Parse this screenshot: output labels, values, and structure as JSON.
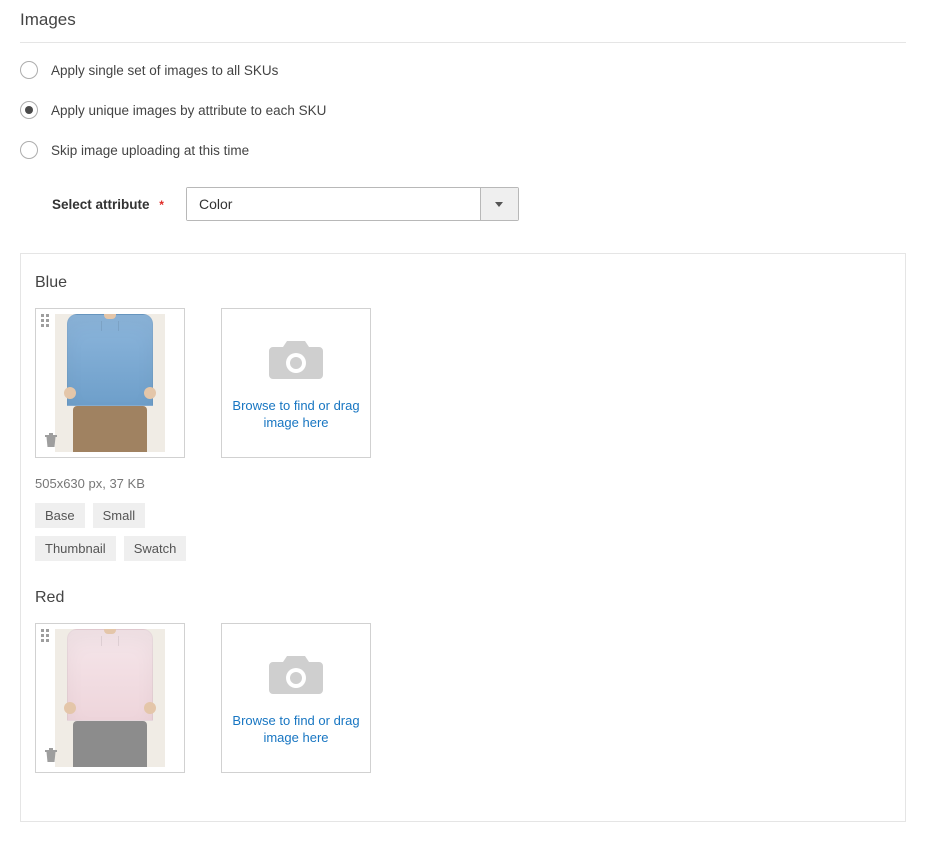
{
  "section_title": "Images",
  "radios": [
    {
      "label": "Apply single set of images to all SKUs",
      "selected": false
    },
    {
      "label": "Apply unique images by attribute to each SKU",
      "selected": true
    },
    {
      "label": "Skip image uploading at this time",
      "selected": false
    }
  ],
  "attribute": {
    "label": "Select attribute",
    "required_marker": "*",
    "value": "Color"
  },
  "dropzone_text": "Browse to find or drag image here",
  "groups": [
    {
      "name": "Blue",
      "image_meta": "505x630 px, 37 KB",
      "tags": [
        "Base",
        "Small",
        "Thumbnail",
        "Swatch"
      ]
    },
    {
      "name": "Red",
      "image_meta": "",
      "tags": []
    }
  ]
}
